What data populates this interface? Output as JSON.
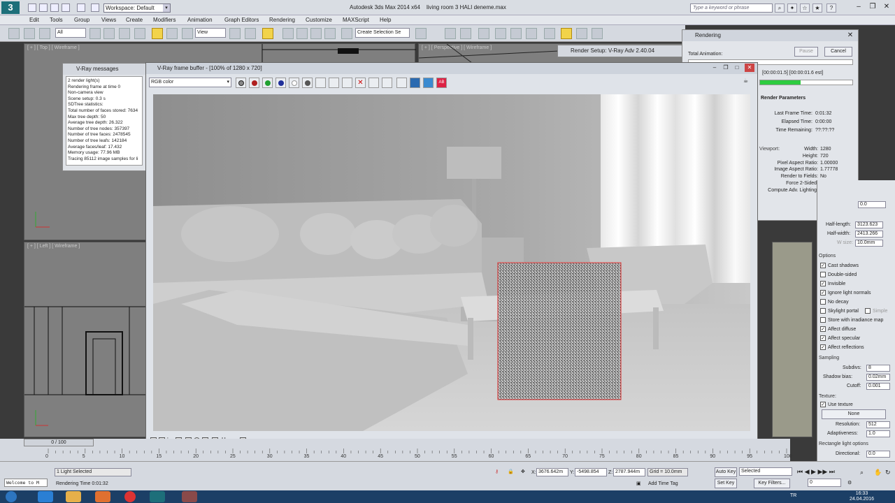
{
  "titlebar": {
    "logo": "3",
    "workspace": "Workspace: Default",
    "app_title": "Autodesk 3ds Max  2014 x64",
    "file_title": "living room 3 HALI deneme.max",
    "search_placeholder": "Type a keyword or phrase"
  },
  "menu": [
    "Edit",
    "Tools",
    "Group",
    "Views",
    "Create",
    "Modifiers",
    "Animation",
    "Graph Editors",
    "Rendering",
    "Customize",
    "MAXScript",
    "Help"
  ],
  "toolbar": {
    "filter": "All",
    "ref_coord": "View",
    "selection_set": "Create Selection Se"
  },
  "viewports": {
    "top": "[ + ] [ Top ] [ Wireframe ]",
    "perspective": "[ + ] [ Perspective ] [ Wireframe ]",
    "left": "[ + ] [ Left ] [ Wireframe ]"
  },
  "vray_messages": {
    "title": "V-Ray messages",
    "lines": [
      "2 render light(s)",
      "Rendering frame at time 0",
      "Non-camera view",
      "Scene setup: 0.3 s",
      "SDTree statistics:",
      "Total number of faces stored: 7634",
      "Max tree depth: 50",
      "Average tree depth: 26.322",
      "Number of tree nodes: 357397",
      "Number of tree faces: 2478545",
      "Number of tree leafs: 142184",
      "Average faces/leaf: 17.432",
      "Memory usage: 77.96 MB",
      "Tracing 85112 image samples for li"
    ]
  },
  "vfb": {
    "title": "V-Ray frame buffer - [100% of 1280 x 720]",
    "channel": "RGB color"
  },
  "render_setup": {
    "title": "Render Setup: V-Ray Adv 2.40.04"
  },
  "rendering_dialog": {
    "title": "Rendering",
    "pause": "Pause",
    "cancel": "Cancel",
    "total_animation": "Total Animation:",
    "progress_text": "[00:00:01.5]  [00:00:01.6 est]",
    "section": "Render Parameters",
    "progress_fraction": 0.44,
    "stats": [
      {
        "key": "Last Frame Time:",
        "value": "0:01:32"
      },
      {
        "key": "Elapsed Time:",
        "value": "0:00:00"
      },
      {
        "key": "Time Remaining:",
        "value": "??:??:??"
      }
    ],
    "viewport_label": "Viewport:",
    "params": [
      {
        "key": "Width:",
        "value": "1280"
      },
      {
        "key": "Height:",
        "value": "720"
      },
      {
        "key": "Pixel Aspect Ratio:",
        "value": "1.00000"
      },
      {
        "key": "Image Aspect Ratio:",
        "value": "1.77778"
      },
      {
        "key": "Render to Fields:",
        "value": "No"
      },
      {
        "key": "Force 2-Sided:",
        "value": "No"
      },
      {
        "key": "Compute Adv. Lighting:",
        "value": "No"
      }
    ]
  },
  "command_panel": {
    "half_length_label": "Half-length:",
    "half_length": "3123.623",
    "half_width_label": "Half-width:",
    "half_width": "2413.266",
    "w_size_label": "W size:",
    "w_size": "10.0mm",
    "top_value": "0.0",
    "options_label": "Options",
    "options": [
      {
        "label": "Cast shadows",
        "checked": true
      },
      {
        "label": "Double-sided",
        "checked": false
      },
      {
        "label": "Invisible",
        "checked": true
      },
      {
        "label": "Ignore light normals",
        "checked": true
      },
      {
        "label": "No decay",
        "checked": false
      },
      {
        "label": "Skylight portal",
        "checked": false
      },
      {
        "label": "Store with irradiance map",
        "checked": false
      },
      {
        "label": "Affect diffuse",
        "checked": true
      },
      {
        "label": "Affect specular",
        "checked": true
      },
      {
        "label": "Affect reflections",
        "checked": true
      }
    ],
    "simple_label": "Simple",
    "sampling_label": "Sampling",
    "subdivs_label": "Subdivs:",
    "subdivs": "8",
    "shadow_bias_label": "Shadow bias:",
    "shadow_bias": "0.02mm",
    "cutoff_label": "Cutoff:",
    "cutoff": "0.001",
    "texture_label": "Texture:",
    "use_texture": "Use texture",
    "texture_none": "None",
    "resolution_label": "Resolution:",
    "resolution": "512",
    "adaptiveness_label": "Adaptiveness:",
    "adaptiveness": "1.0",
    "rect_options": "Rectangle light options",
    "directional_label": "Directional:",
    "directional": "0.0"
  },
  "timeline": {
    "slider": "0 / 100",
    "ticks": [
      "0",
      "5",
      "10",
      "15",
      "20",
      "25",
      "30",
      "35",
      "40",
      "45",
      "50",
      "55",
      "60",
      "65",
      "70",
      "75",
      "80",
      "85",
      "90",
      "95",
      "100"
    ]
  },
  "status": {
    "selection": "1 Light Selected",
    "render_time": "Rendering Time  0:01:32",
    "x_label": "X:",
    "x": "3676.642m",
    "y_label": "Y:",
    "y": "-5498.854",
    "z_label": "Z:",
    "z": "2787.944m",
    "grid": "Grid = 10.0mm",
    "add_time_tag": "Add Time Tag",
    "auto_key": "Auto Key",
    "selected": "Selected",
    "set_key": "Set Key",
    "key_filters": "Key Filters...",
    "frame": "0",
    "maxscript": "Welcome to M"
  },
  "taskbar": {
    "lang": "TR",
    "time": "16:33",
    "date": "24.04.2016"
  },
  "colors": {
    "accent_yellow": "#f2d34a",
    "progress_green": "#2ecc40",
    "bucket_red": "#e03030",
    "taskbar": "#1c3f66"
  }
}
